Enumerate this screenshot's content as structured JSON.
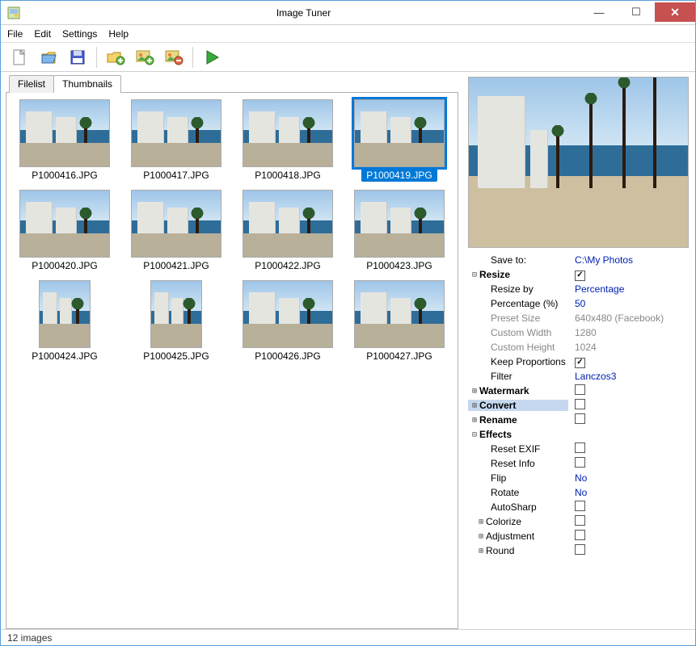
{
  "window": {
    "title": "Image Tuner"
  },
  "menu": {
    "file": "File",
    "edit": "Edit",
    "settings": "Settings",
    "help": "Help"
  },
  "tabs": {
    "filelist": "Filelist",
    "thumbnails": "Thumbnails"
  },
  "thumbnails": [
    {
      "name": "P1000416.JPG",
      "orient": "land",
      "selected": false
    },
    {
      "name": "P1000417.JPG",
      "orient": "land",
      "selected": false
    },
    {
      "name": "P1000418.JPG",
      "orient": "land",
      "selected": false
    },
    {
      "name": "P1000419.JPG",
      "orient": "land",
      "selected": true
    },
    {
      "name": "P1000420.JPG",
      "orient": "land",
      "selected": false
    },
    {
      "name": "P1000421.JPG",
      "orient": "land",
      "selected": false
    },
    {
      "name": "P1000422.JPG",
      "orient": "land",
      "selected": false
    },
    {
      "name": "P1000423.JPG",
      "orient": "land",
      "selected": false
    },
    {
      "name": "P1000424.JPG",
      "orient": "port",
      "selected": false
    },
    {
      "name": "P1000425.JPG",
      "orient": "port",
      "selected": false
    },
    {
      "name": "P1000426.JPG",
      "orient": "land",
      "selected": false
    },
    {
      "name": "P1000427.JPG",
      "orient": "land",
      "selected": false
    }
  ],
  "props": {
    "save_to_label": "Save to:",
    "save_to_value": "C:\\My Photos",
    "resize": {
      "label": "Resize",
      "checked": true,
      "resize_by_label": "Resize by",
      "resize_by_value": "Percentage",
      "percent_label": "Percentage (%)",
      "percent_value": "50",
      "preset_label": "Preset Size",
      "preset_value": "640x480 (Facebook)",
      "cw_label": "Custom Width",
      "cw_value": "1280",
      "ch_label": "Custom Height",
      "ch_value": "1024",
      "keep_label": "Keep Proportions",
      "keep_checked": true,
      "filter_label": "Filter",
      "filter_value": "Lanczos3"
    },
    "watermark": {
      "label": "Watermark",
      "checked": false
    },
    "convert": {
      "label": "Convert",
      "checked": false
    },
    "rename": {
      "label": "Rename",
      "checked": false
    },
    "effects": {
      "label": "Effects",
      "reset_exif_label": "Reset EXIF",
      "reset_exif_checked": false,
      "reset_info_label": "Reset Info",
      "reset_info_checked": false,
      "flip_label": "Flip",
      "flip_value": "No",
      "rotate_label": "Rotate",
      "rotate_value": "No",
      "autosharp_label": "AutoSharp",
      "autosharp_checked": false,
      "colorize_label": "Colorize",
      "colorize_checked": false,
      "adjustment_label": "Adjustment",
      "adjustment_checked": false,
      "round_label": "Round",
      "round_checked": false
    }
  },
  "status": {
    "text": "12 images"
  }
}
